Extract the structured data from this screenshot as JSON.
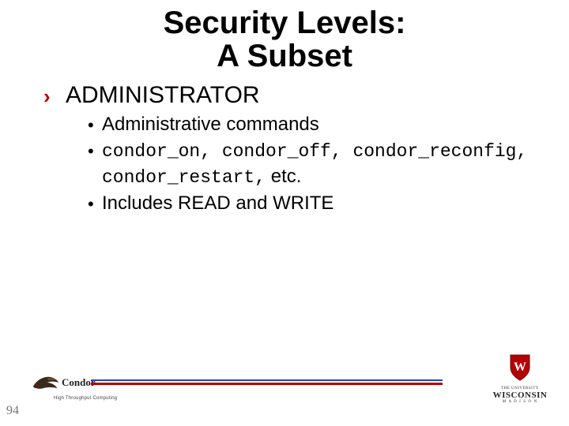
{
  "title_line1": "Security Levels:",
  "title_line2": "A Subset",
  "section_heading": "ADMINISTRATOR",
  "bullets": {
    "b1": "Administrative commands",
    "b2_code": "condor_on, condor_off, condor_reconfig, condor_restart,",
    "b2_tail": "etc.",
    "b3": "Includes READ and WRITE"
  },
  "page_number": "94",
  "condor": {
    "name": "Condor",
    "subtitle": "High Throughput Computing"
  },
  "uw": {
    "line1": "THE UNIVERSITY",
    "line2": "WISCONSIN",
    "line3": "M A D I S O N"
  }
}
